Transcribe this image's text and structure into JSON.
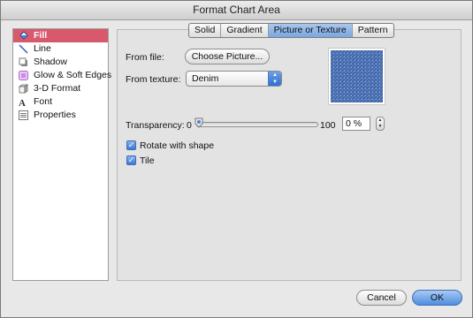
{
  "window": {
    "title": "Format Chart Area"
  },
  "sidebar": {
    "items": [
      {
        "label": "Fill",
        "icon": "fill-bucket-icon",
        "selected": true
      },
      {
        "label": "Line",
        "icon": "line-icon"
      },
      {
        "label": "Shadow",
        "icon": "shadow-icon"
      },
      {
        "label": "Glow & Soft Edges",
        "icon": "glow-icon"
      },
      {
        "label": "3-D Format",
        "icon": "3d-format-icon"
      },
      {
        "label": "Font",
        "icon": "font-icon"
      },
      {
        "label": "Properties",
        "icon": "properties-icon"
      }
    ]
  },
  "tabs": [
    {
      "label": "Solid"
    },
    {
      "label": "Gradient"
    },
    {
      "label": "Picture or Texture",
      "active": true
    },
    {
      "label": "Pattern"
    }
  ],
  "picture": {
    "from_file_label": "From file:",
    "choose_picture_label": "Choose Picture...",
    "from_texture_label": "From texture:",
    "texture_value": "Denim",
    "preview_icon": "denim-texture-swatch"
  },
  "transparency": {
    "label": "Transparency:",
    "min_label": "0",
    "max_label": "100",
    "value_text": "0 %",
    "value": 0
  },
  "options": {
    "rotate_with_shape": {
      "label": "Rotate with shape",
      "checked": true
    },
    "tile": {
      "label": "Tile",
      "checked": true
    }
  },
  "footer": {
    "cancel_label": "Cancel",
    "ok_label": "OK"
  },
  "colors": {
    "selected_item": "#d8596c",
    "accent_blue": "#3b78d4",
    "denim": "#4a6fb0"
  }
}
